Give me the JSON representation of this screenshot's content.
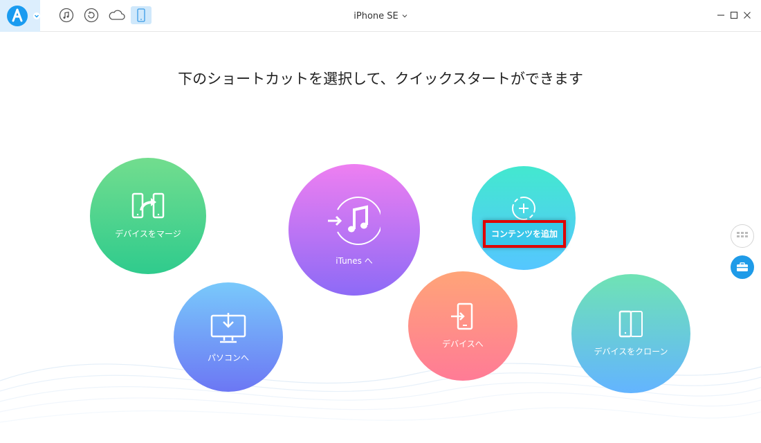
{
  "window": {
    "device_name": "iPhone SE"
  },
  "toolbar": {
    "icons": [
      "app-logo-icon",
      "music-note-icon",
      "restore-icon",
      "cloud-icon",
      "phone-icon"
    ]
  },
  "main": {
    "heading": "下のショートカットを選択して、クイックスタートができます",
    "shortcuts": {
      "merge": "デバイスをマージ",
      "to_pc": "パソコンへ",
      "to_itunes": "iTunes へ",
      "add_content": "コンテンツを追加",
      "to_device": "デバイスへ",
      "clone": "デバイスをクローン"
    }
  },
  "colors": {
    "accent": "#1a9bf0",
    "highlight_border": "#e00000",
    "merge": [
      "#72dd8e",
      "#2fcb8d"
    ],
    "to_pc": [
      "#79c9fb",
      "#6c77f4"
    ],
    "to_itunes": [
      "#ee7ff1",
      "#8d6af6"
    ],
    "add_content": [
      "#43e8cf",
      "#55c6ff"
    ],
    "to_device": [
      "#ffa478",
      "#ff7b96"
    ],
    "clone": [
      "#6fe3b4",
      "#63b4ff"
    ]
  }
}
